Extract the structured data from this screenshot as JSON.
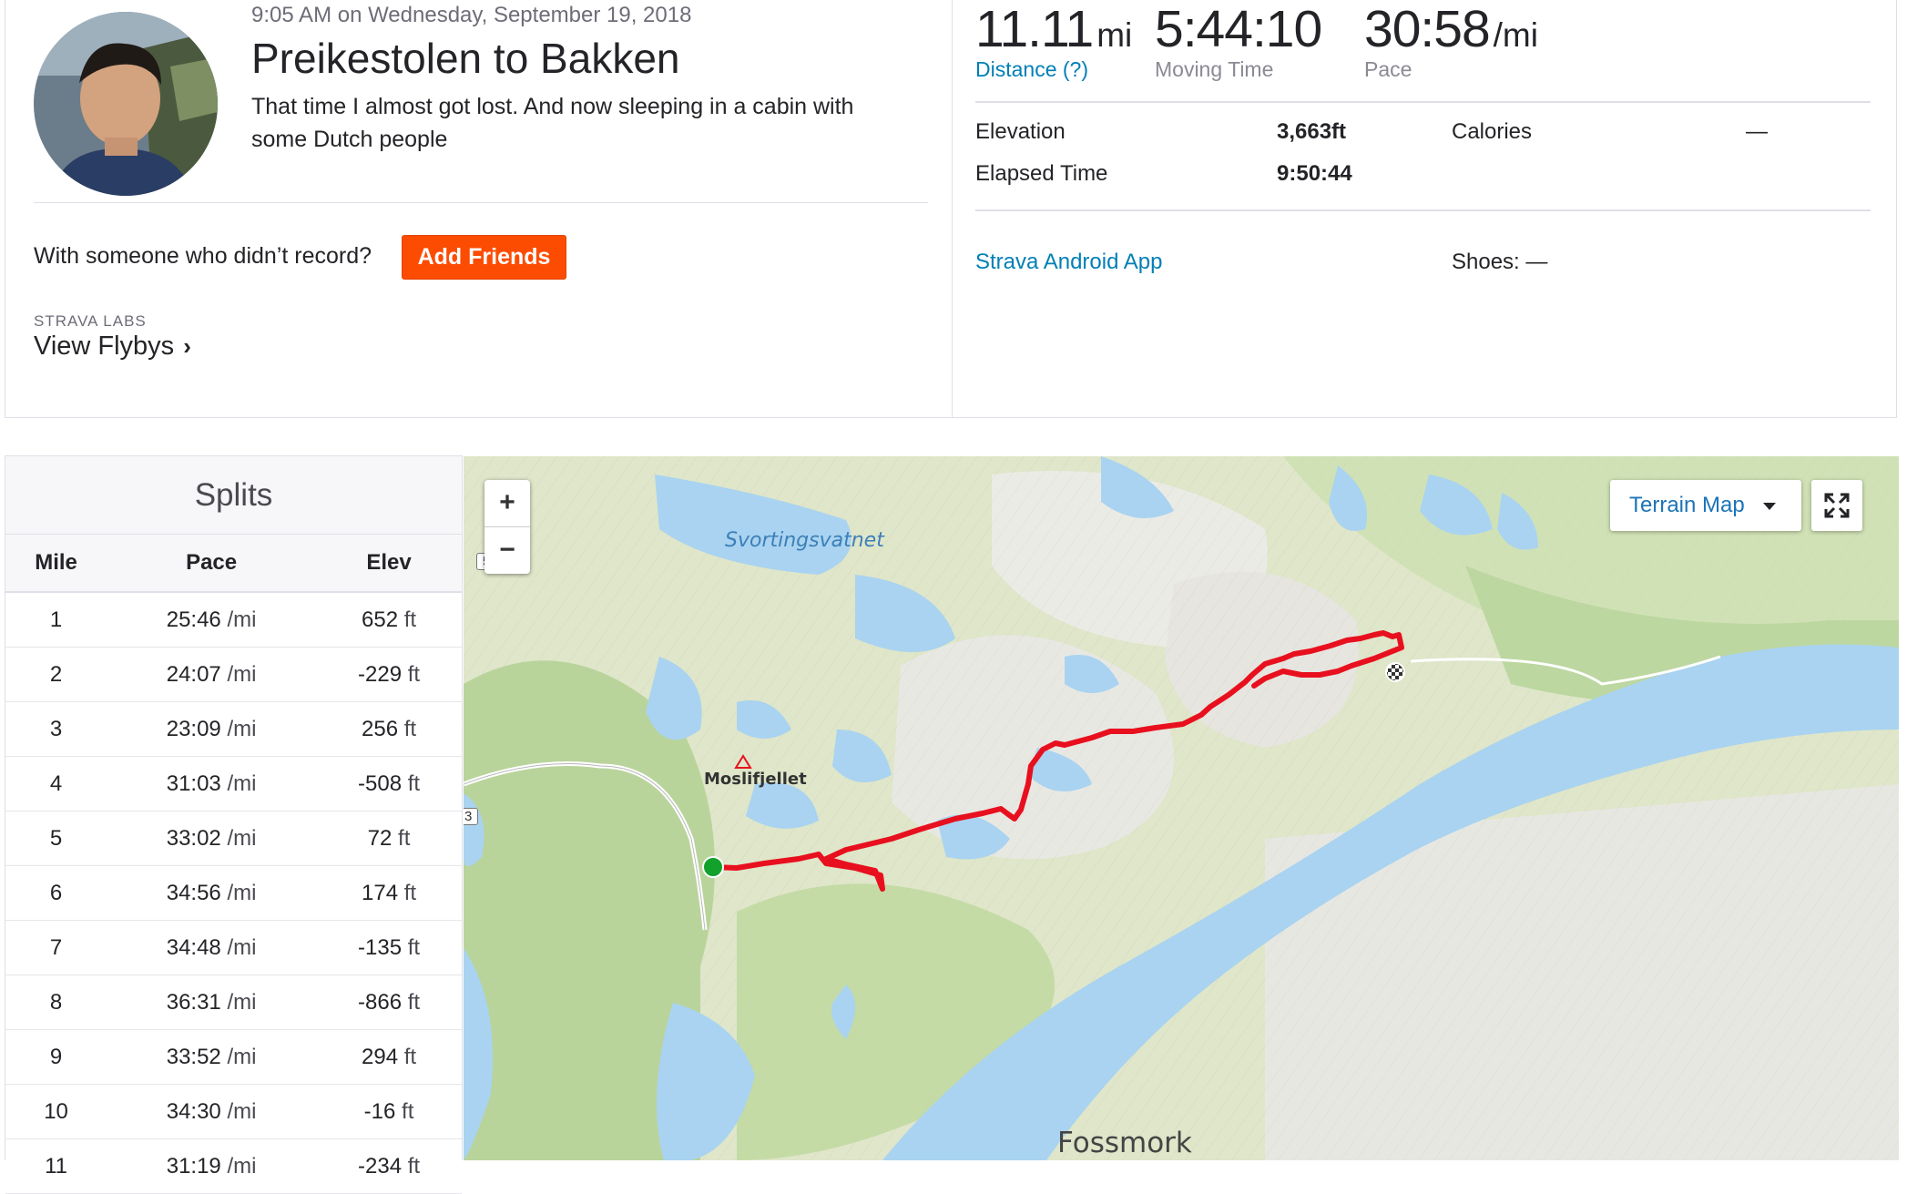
{
  "activity": {
    "timestamp": "9:05 AM on Wednesday, September 19, 2018",
    "title": "Preikestolen to Bakken",
    "description": "That time I almost got lost. And now sleeping in a cabin with some Dutch people"
  },
  "friends": {
    "prompt": "With someone who didn’t record?",
    "button": "Add Friends"
  },
  "labs": {
    "label": "STRAVA LABS",
    "link": "View Flybys",
    "chevron": "›"
  },
  "stats": {
    "distance": {
      "value": "11.11",
      "unit": "mi",
      "label": "Distance (?)"
    },
    "moving_time": {
      "value": "5:44:10",
      "label": "Moving Time"
    },
    "pace": {
      "value": "30:58",
      "unit": "/mi",
      "label": "Pace"
    },
    "elevation": {
      "label": "Elevation",
      "value": "3,663ft"
    },
    "calories": {
      "label": "Calories",
      "value": "—"
    },
    "elapsed": {
      "label": "Elapsed Time",
      "value": "9:50:44"
    },
    "device": "Strava Android App",
    "shoes": "Shoes: —"
  },
  "splits": {
    "title": "Splits",
    "headers": [
      "Mile",
      "Pace",
      "Elev"
    ],
    "pace_unit": "/mi",
    "elev_unit": "ft",
    "rows": [
      {
        "mile": "1",
        "pace": "25:46",
        "elev": "652"
      },
      {
        "mile": "2",
        "pace": "24:07",
        "elev": "-229"
      },
      {
        "mile": "3",
        "pace": "23:09",
        "elev": "256"
      },
      {
        "mile": "4",
        "pace": "31:03",
        "elev": "-508"
      },
      {
        "mile": "5",
        "pace": "33:02",
        "elev": "72"
      },
      {
        "mile": "6",
        "pace": "34:56",
        "elev": "174"
      },
      {
        "mile": "7",
        "pace": "34:48",
        "elev": "-135"
      },
      {
        "mile": "8",
        "pace": "36:31",
        "elev": "-866"
      },
      {
        "mile": "9",
        "pace": "33:52",
        "elev": "294"
      },
      {
        "mile": "10",
        "pace": "34:30",
        "elev": "-16"
      },
      {
        "mile": "11",
        "pace": "31:19",
        "elev": "-234"
      }
    ]
  },
  "map": {
    "zoom_in": "+",
    "zoom_out": "−",
    "map_type": "Terrain Map",
    "labels": {
      "lake": "Svortingsvatnet",
      "peak": "Moslifjellet",
      "town": "Fossmork",
      "road_527": "527",
      "road_partial": "3"
    },
    "colors": {
      "route": "#e8101e",
      "water": "#a9d3f0",
      "land": "#d8e6c0",
      "start": "#12a12a"
    }
  },
  "colors": {
    "brand": "#fc4c02",
    "link": "#007fb6"
  }
}
